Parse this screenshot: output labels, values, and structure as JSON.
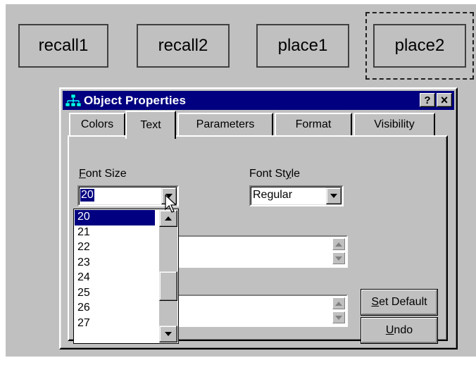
{
  "canvas_objects": [
    {
      "label": "recall1"
    },
    {
      "label": "recall2"
    },
    {
      "label": "place1"
    },
    {
      "label": "place2",
      "selected": true
    }
  ],
  "dialog": {
    "title": "Object Properties",
    "help_button": "?",
    "close_button": "×",
    "tabs": [
      {
        "label": "Colors"
      },
      {
        "label": "Text",
        "active": true
      },
      {
        "label": "Parameters"
      },
      {
        "label": "Format"
      },
      {
        "label": "Visibility"
      }
    ],
    "font_size": {
      "label_hotkey": "F",
      "label_rest": "ont Size",
      "value": "20",
      "options": [
        "20",
        "21",
        "22",
        "23",
        "24",
        "25",
        "26",
        "27"
      ],
      "selected": "20"
    },
    "font_style": {
      "label_pre": "Font St",
      "label_hotkey": "y",
      "label_rest": "le",
      "value": "Regular"
    },
    "buttons": {
      "set_default_hotkey": "S",
      "set_default_rest": "et Default",
      "undo_hotkey": "U",
      "undo_rest": "ndo"
    }
  },
  "colors": {
    "canvas": "#c0c0c0",
    "titlebar": "#000080",
    "selection": "#000080"
  }
}
